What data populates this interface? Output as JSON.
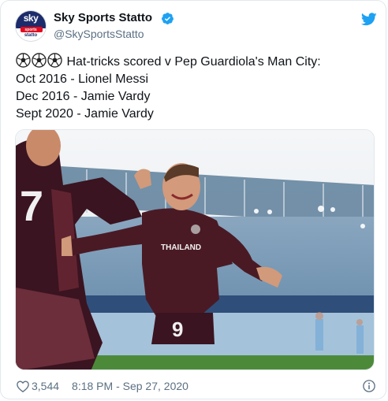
{
  "account": {
    "display_name": "Sky Sports Statto",
    "handle": "@SkySportsStatto",
    "avatar_logo_text": "sky",
    "avatar_sub_text": "sports",
    "avatar_name_text": "statto"
  },
  "tweet": {
    "lines": [
      "Hat-tricks scored v Pep Guardiola's Man City:",
      "Oct 2016 - Lionel Messi",
      "Dec 2016 - Jamie Vardy",
      "Sept 2020 - Jamie Vardy"
    ],
    "emoji": [
      "soccer-ball-icon",
      "soccer-ball-icon",
      "soccer-ball-icon"
    ]
  },
  "media": {
    "jersey_back_number": "7",
    "jersey_front_number": "9",
    "shirt_sponsor": "THAILAND"
  },
  "footer": {
    "like_count": "3,544",
    "timestamp": "8:18 PM - Sep 27, 2020"
  },
  "colors": {
    "twitter_blue": "#1da1f2",
    "text_secondary": "#5b7083",
    "leicester_shirt": "#4a1a24"
  }
}
